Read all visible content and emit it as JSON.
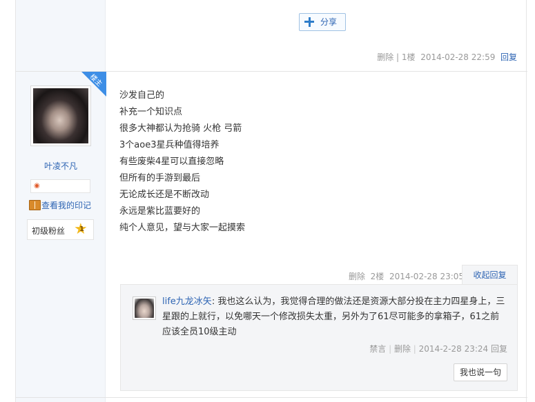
{
  "share": {
    "label": "分享"
  },
  "floor1": {
    "delete": "删除",
    "sep": "|",
    "floor": "1楼",
    "time": "2014-02-28 22:59",
    "reply": "回复"
  },
  "user": {
    "badge": "楼主",
    "name": "叶凌不凡",
    "my_marks": "查看我的印记",
    "fan_level": "初级粉丝",
    "fan_level_num": "1"
  },
  "post": {
    "lines": [
      "沙发自己的",
      "补充一个知识点",
      "很多大神都认为抢骑 火枪 弓箭",
      "3个aoe3星兵种值得培养",
      "有些废柴4星可以直接忽略",
      "但所有的手游到最后",
      "无论成长还是不断改动",
      "永远是紫比蓝要好的",
      "纯个人意见，望与大家一起摸索"
    ]
  },
  "floor2": {
    "delete": "删除",
    "floor": "2楼",
    "time": "2014-02-28 23:05",
    "collapse_reply": "收起回复"
  },
  "reply": {
    "author": "life九龙冰矢",
    "text": ": 我也这么认为，我觉得合理的做法还是资源大部分投在主力四星身上，三星跟的上就行，以免哪天一个修改损失太重，另外为了61尽可能多的拿箱子，61之前应该全员10级主动",
    "ban": "禁言",
    "delete": "删除",
    "time": "2014-2-28 23:24",
    "reply": "回复",
    "sep": "|",
    "say_button": "我也说一句"
  },
  "colors": {
    "link": "#2d64b3",
    "badge": "#3d8ee6",
    "left_bg": "#f4f7fb"
  }
}
